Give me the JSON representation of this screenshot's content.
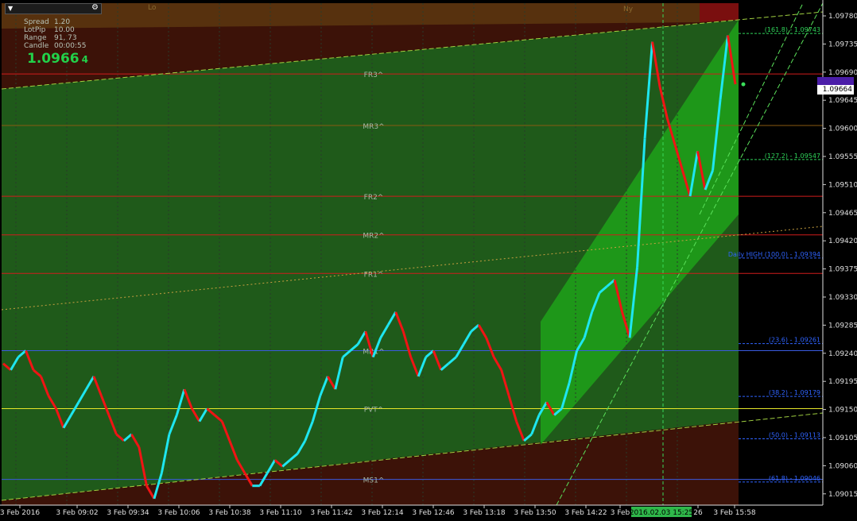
{
  "window": {
    "menu_icon": "dropdown-arrow-icon",
    "settings_icon": "gear-icon"
  },
  "info_panel": {
    "rows": [
      {
        "label": "Spread",
        "value": "1.20"
      },
      {
        "label": "LotPip",
        "value": "10.00"
      },
      {
        "label": "Range",
        "value": "91, 73"
      },
      {
        "label": "Candle",
        "value": "00:00:55"
      }
    ],
    "price_main": "1.0966",
    "price_pip": "4"
  },
  "session_labels": {
    "london": "Lo",
    "newyork": "Ny"
  },
  "price_axis": {
    "ticks": [
      "1.09780",
      "1.09735",
      "1.09690",
      "1.09645",
      "1.09600",
      "1.09555",
      "1.09510",
      "1.09465",
      "1.09420",
      "1.09375",
      "1.09330",
      "1.09285",
      "1.09240",
      "1.09195",
      "1.09150",
      "1.09105",
      "1.09060",
      "1.09015"
    ],
    "current_price_label": "1.09664",
    "purple_label": "1.09664"
  },
  "time_axis": {
    "ticks": [
      "3 Feb 2016",
      "3 Feb 09:02",
      "3 Feb 09:34",
      "3 Feb 10:06",
      "3 Feb 10:38",
      "3 Feb 11:10",
      "3 Feb 11:42",
      "3 Feb 12:14",
      "3 Feb 12:46",
      "3 Feb 13:18",
      "3 Feb 13:50",
      "3 Feb 14:22",
      "3 Feb",
      "26",
      "3 Feb 15:58"
    ],
    "crosshair_label": "2016.02.03 15:25"
  },
  "pivot_levels": [
    {
      "name": "FR3^",
      "price": 1.0968,
      "color": "#d01c1c"
    },
    {
      "name": "MR3^",
      "price": 1.096,
      "color": "#8a5a10"
    },
    {
      "name": "FR2^",
      "price": 1.0949,
      "color": "#d01c1c"
    },
    {
      "name": "MR2^",
      "price": 1.0943,
      "color": "#d01c1c"
    },
    {
      "name": "FR1^",
      "price": 1.0937,
      "color": "#d01c1c"
    },
    {
      "name": "MR1^",
      "price": 1.0925,
      "color": "#3a5adf"
    },
    {
      "name": "PVT^",
      "price": 1.0916,
      "color": "#e6e62a"
    },
    {
      "name": "MS1^",
      "price": 1.0905,
      "color": "#3a5adf"
    }
  ],
  "fib_labels": [
    {
      "text": "(161.8) - 1.09743",
      "color": "#2fd45a"
    },
    {
      "text": "(127.2) - 1.09547",
      "color": "#2fd45a"
    },
    {
      "text": "Daily HIGH (100.0) - 1.09394",
      "color": "#2f64ff"
    },
    {
      "text": "(23.6) - 1.09261",
      "color": "#2f64ff"
    },
    {
      "text": "(38.2) - 1.09179",
      "color": "#2f64ff"
    },
    {
      "text": "(50.0) - 1.09113",
      "color": "#2f64ff"
    },
    {
      "text": "(61.8) - 1.09046",
      "color": "#2f64ff"
    }
  ],
  "colors": {
    "background": "#000000",
    "green_zone": "#1f5a1a",
    "brown_zone": "#3c1208",
    "channel_fill": "#1ea21a",
    "candle_up": "#1ee6f0",
    "candle_down": "#f01414",
    "grid": "#2a3a2a"
  },
  "chart_data": {
    "type": "line",
    "title": "",
    "ylim": [
      1.0901,
      1.0979
    ],
    "series": [
      {
        "name": "",
        "values": [
          1.0923,
          1.0922,
          1.0924,
          1.0925,
          1.0922,
          1.0921,
          1.0918,
          1.0916,
          1.0913,
          1.0915,
          1.0917,
          1.0919,
          1.0921,
          1.0918,
          1.0915,
          1.0912,
          1.0911,
          1.0912,
          1.091,
          1.0904,
          1.0902,
          1.0906,
          1.0912,
          1.0915,
          1.0919,
          1.0916,
          1.0914,
          1.0916,
          1.0915,
          1.0914,
          1.0911,
          1.0908,
          1.0906,
          1.0904,
          1.0904,
          1.0906,
          1.0908,
          1.0907,
          1.0908,
          1.0909,
          1.0911,
          1.0914,
          1.0918,
          1.0921,
          1.0919,
          1.0924,
          1.0925,
          1.0926,
          1.0928,
          1.0924,
          1.0927,
          1.0929,
          1.0931,
          1.0928,
          1.0924,
          1.0921,
          1.0924,
          1.0925,
          1.0922,
          1.0923,
          1.0924,
          1.0926,
          1.0928,
          1.0929,
          1.0927,
          1.0924,
          1.0922,
          1.0918,
          1.0914,
          1.0911,
          1.0912,
          1.0915,
          1.0917,
          1.0915,
          1.0916,
          1.092,
          1.0925,
          1.0927,
          1.0931,
          1.0934,
          1.0935,
          1.0936,
          1.0931,
          1.0927,
          1.0938,
          1.0958,
          1.0973,
          1.0966,
          1.0961,
          1.0957,
          1.0953,
          1.0949,
          1.0956,
          1.095,
          1.0953,
          1.0964,
          1.0974,
          1.09664
        ]
      }
    ]
  }
}
